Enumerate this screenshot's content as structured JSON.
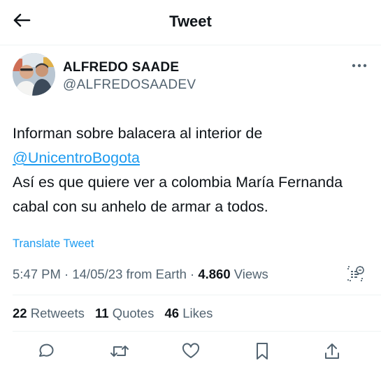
{
  "header": {
    "title": "Tweet",
    "back_icon": "arrow-left-icon"
  },
  "author": {
    "name": "ALFREDO SAADE",
    "handle": "@ALFREDOSAADEV",
    "more_icon": "more-horizontal-icon"
  },
  "tweet": {
    "line1": "Informan sobre balacera al interior de",
    "mention": "@UnicentroBogota",
    "line3": "Así es que quiere ver a colombia María Fernanda",
    "line4": "cabal con su anhelo de armar a todos."
  },
  "translate_label": "Translate Tweet",
  "meta": {
    "time": "5:47 PM",
    "separator": "·",
    "date": "14/05/23",
    "source": "from Earth",
    "views_count": "4.860",
    "views_label": "Views"
  },
  "stats": [
    {
      "count": "22",
      "label": "Retweets"
    },
    {
      "count": "11",
      "label": "Quotes"
    },
    {
      "count": "46",
      "label": "Likes"
    }
  ],
  "actions": [
    {
      "icon": "reply-icon"
    },
    {
      "icon": "retweet-icon"
    },
    {
      "icon": "like-icon"
    },
    {
      "icon": "bookmark-icon"
    },
    {
      "icon": "share-icon"
    }
  ],
  "colors": {
    "accent": "#1d9bf0",
    "text": "#0f1419",
    "secondary": "#536471",
    "divider": "#eff3f4"
  }
}
